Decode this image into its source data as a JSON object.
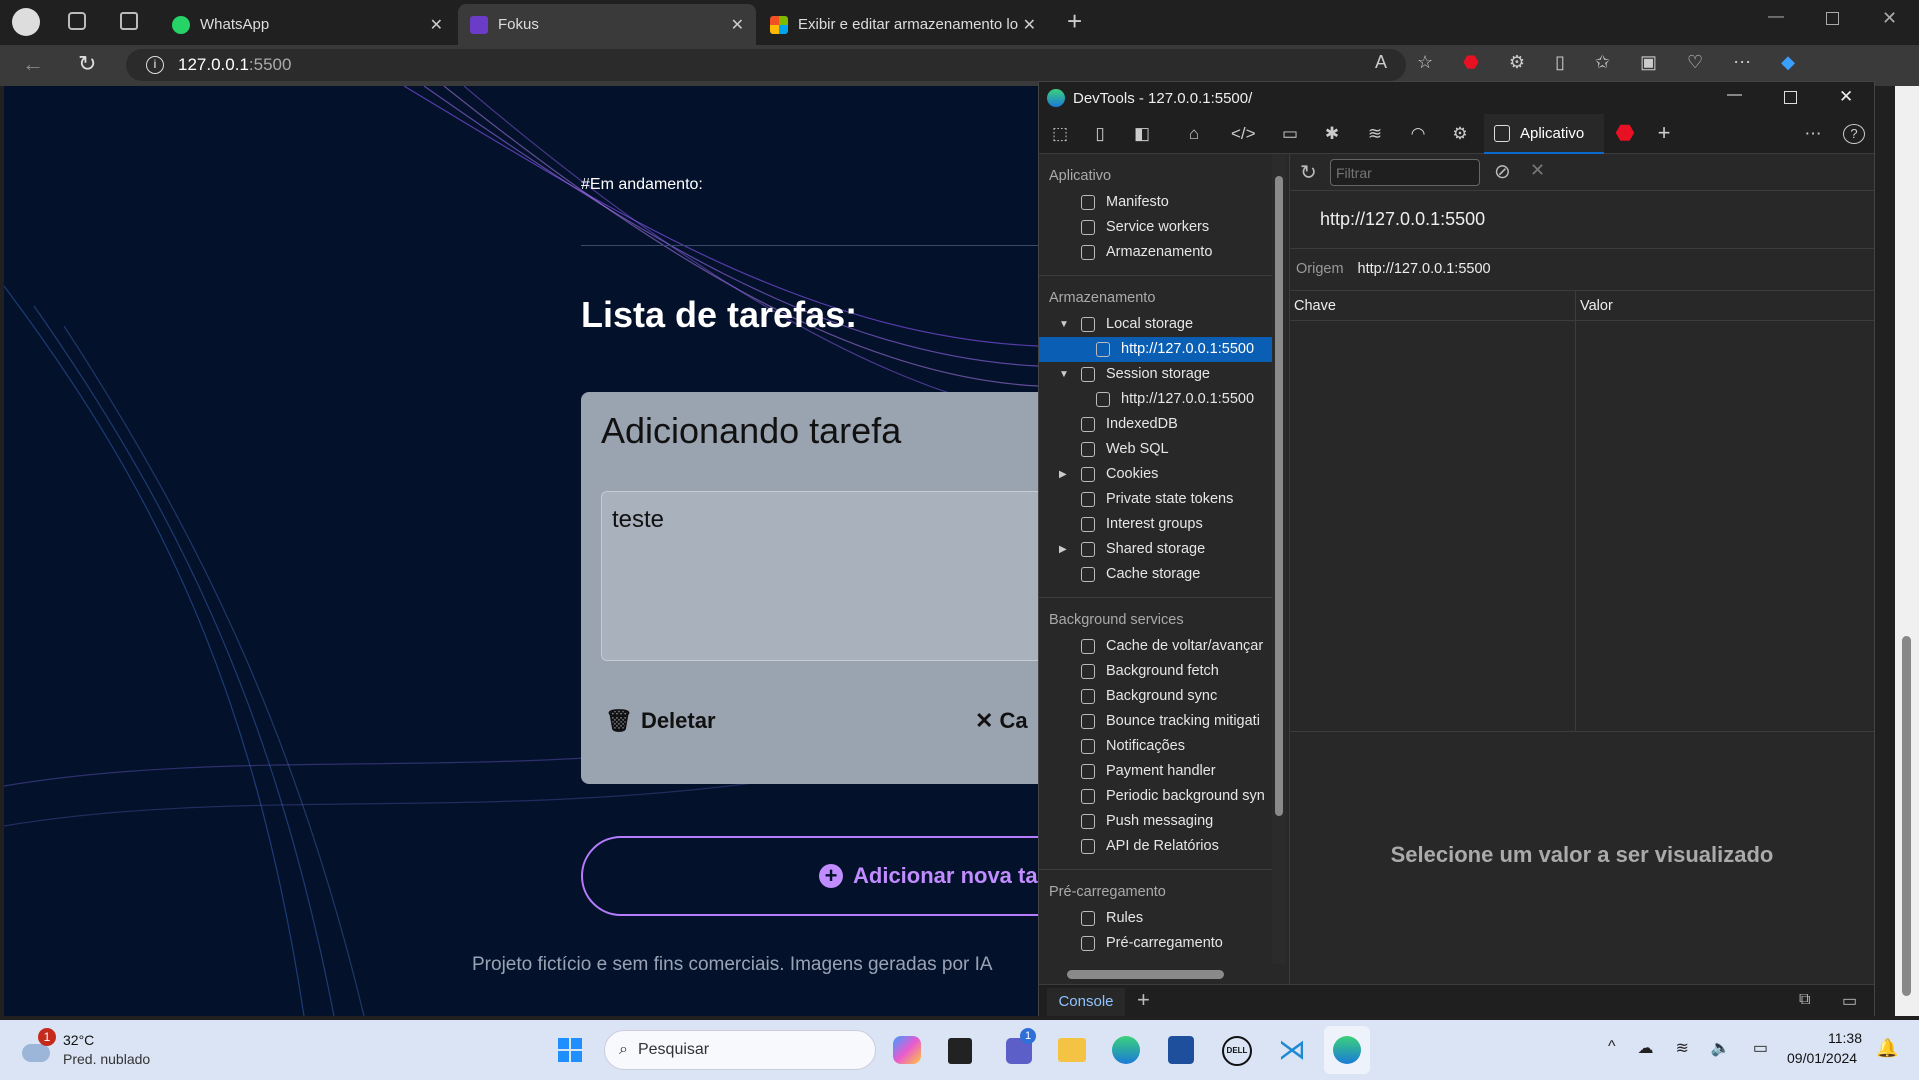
{
  "browser": {
    "tabs": [
      {
        "title": "WhatsApp",
        "icon": "whatsapp-icon"
      },
      {
        "title": "Fokus",
        "icon": "fokus-icon"
      },
      {
        "title": "Exibir e editar armazenamento lo",
        "icon": "microsoft-icon"
      }
    ],
    "url_host": "127.0.0.1",
    "url_port": ":5500"
  },
  "page": {
    "in_progress": "#Em andamento:",
    "list_title": "Lista de tarefas:",
    "form_title": "Adicionando tarefa",
    "textarea_value": "teste",
    "delete_label": "Deletar",
    "cancel_label": "Ca",
    "add_label": "Adicionar nova ta",
    "footer": "Projeto fictício e sem fins comerciais. Imagens geradas por IA"
  },
  "devtools": {
    "title": "DevTools - 127.0.0.1:5500/",
    "active_tab": "Aplicativo",
    "filter_placeholder": "Filtrar",
    "sections": [
      {
        "header": "Aplicativo",
        "items": [
          {
            "label": "Manifesto"
          },
          {
            "label": "Service workers"
          },
          {
            "label": "Armazenamento"
          }
        ]
      },
      {
        "header": "Armazenamento",
        "items": [
          {
            "label": "Local storage",
            "expanded": true
          },
          {
            "label": "http://127.0.0.1:5500",
            "sub": true,
            "selected": true
          },
          {
            "label": "Session storage",
            "expanded": true
          },
          {
            "label": "http://127.0.0.1:5500",
            "sub": true
          },
          {
            "label": "IndexedDB"
          },
          {
            "label": "Web SQL"
          },
          {
            "label": "Cookies",
            "collapsed": true
          },
          {
            "label": "Private state tokens"
          },
          {
            "label": "Interest groups"
          },
          {
            "label": "Shared storage",
            "collapsed": true
          },
          {
            "label": "Cache storage"
          }
        ]
      },
      {
        "header": "Background services",
        "items": [
          {
            "label": "Cache de voltar/avançar"
          },
          {
            "label": "Background fetch"
          },
          {
            "label": "Background sync"
          },
          {
            "label": "Bounce tracking mitigati"
          },
          {
            "label": "Notificações"
          },
          {
            "label": "Payment handler"
          },
          {
            "label": "Periodic background syn"
          },
          {
            "label": "Push messaging"
          },
          {
            "label": "API de Relatórios"
          }
        ]
      },
      {
        "header": "Pré-carregamento",
        "items": [
          {
            "label": "Rules"
          },
          {
            "label": "Pré-carregamento"
          }
        ]
      }
    ],
    "origin_url": "http://127.0.0.1:5500",
    "origin_label": "Origem",
    "origin_value": "http://127.0.0.1:5500",
    "col_key": "Chave",
    "col_value": "Valor",
    "empty_msg": "Selecione um valor a ser visualizado",
    "console_tab": "Console"
  },
  "taskbar": {
    "temp": "32°C",
    "weather": "Pred. nublado",
    "weather_badge": "1",
    "search": "Pesquisar",
    "time": "11:38",
    "date": "09/01/2024",
    "teams_badge": "1"
  }
}
